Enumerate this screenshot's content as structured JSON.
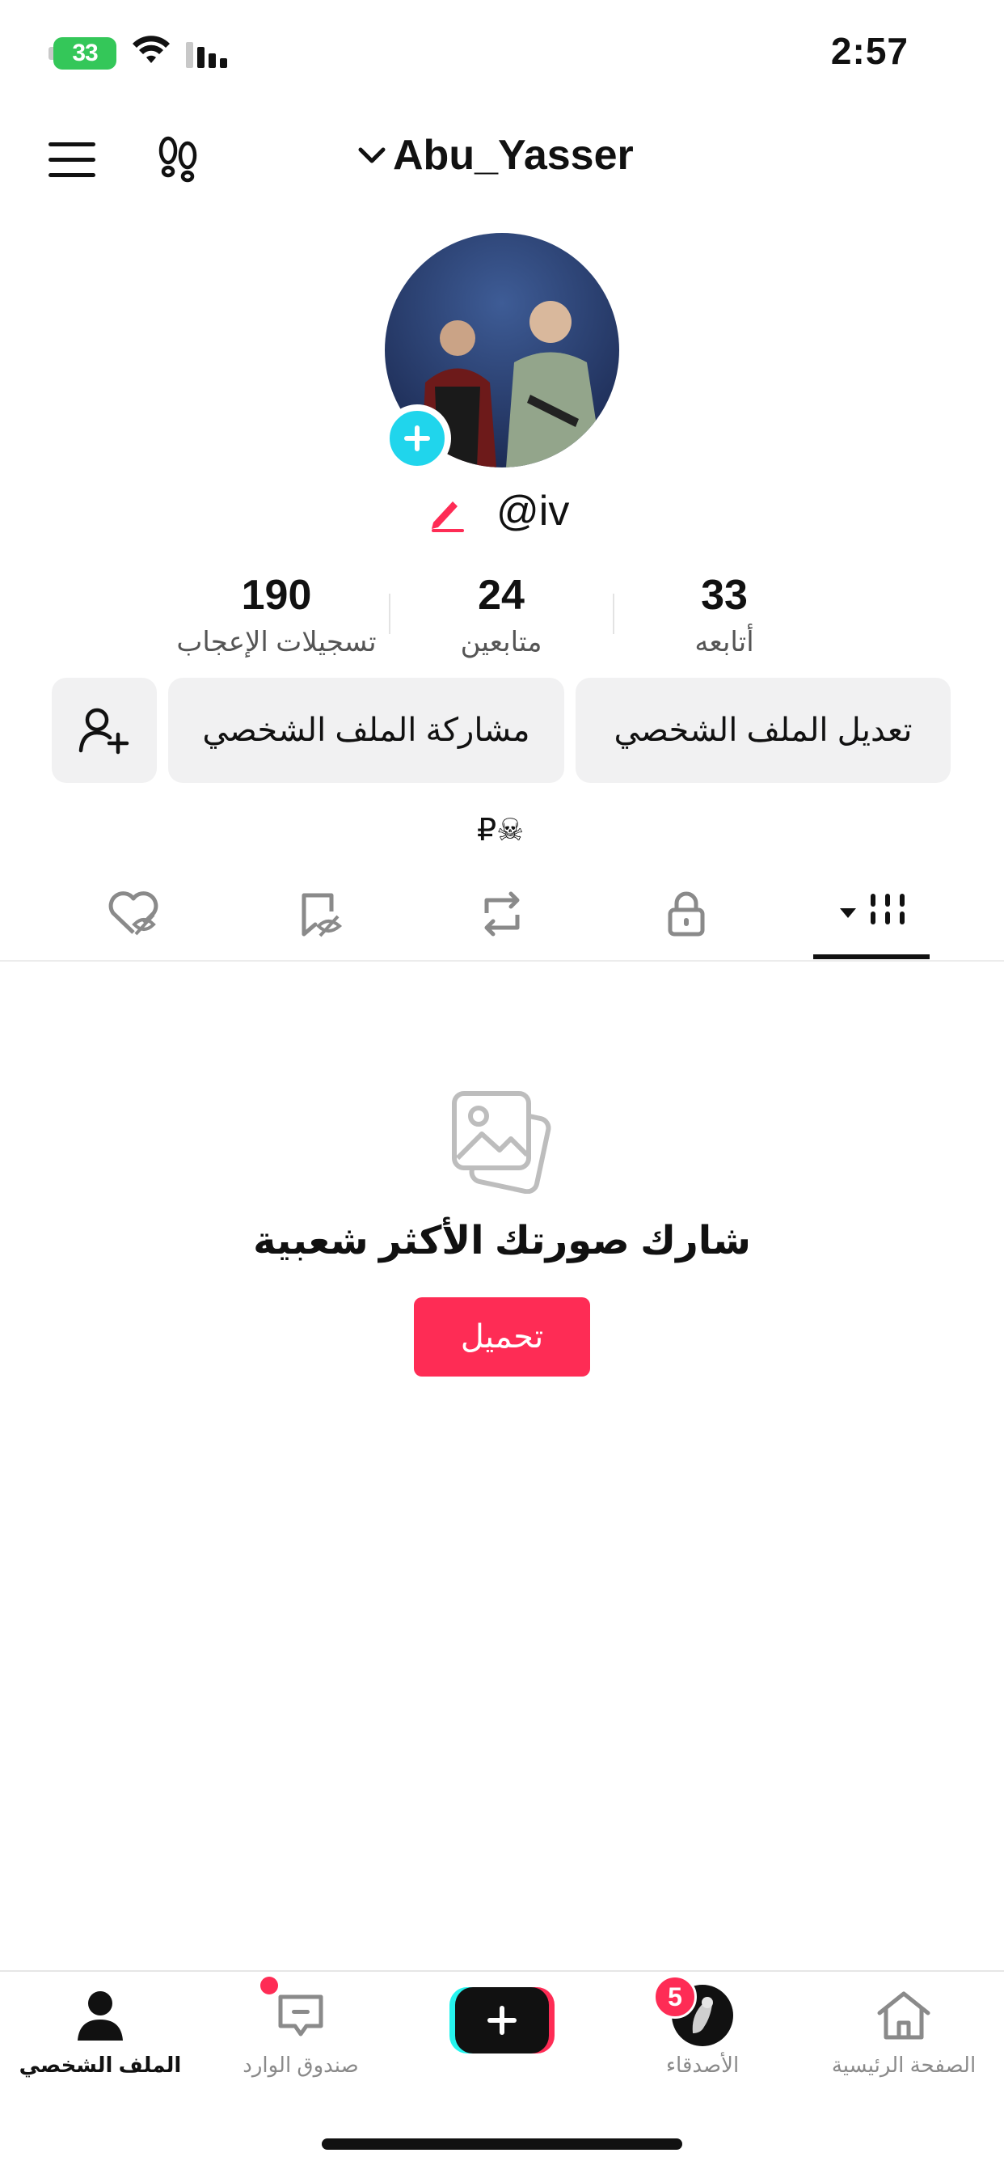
{
  "status_bar": {
    "battery_level": "33",
    "time": "2:57"
  },
  "header": {
    "username": "Abu_Yasser"
  },
  "profile": {
    "handle": "@iv",
    "bio": "₽☠",
    "stats": [
      {
        "count": "190",
        "label": "تسجيلات الإعجاب"
      },
      {
        "count": "24",
        "label": "متابعين"
      },
      {
        "count": "33",
        "label": "أتابعه"
      }
    ],
    "buttons": {
      "share_profile": "مشاركة الملف الشخصي",
      "edit_profile": "تعديل الملف الشخصي"
    }
  },
  "content": {
    "empty_message": "شارك صورتك الأكثر شعبية",
    "upload_label": "تحميل"
  },
  "bottom_nav": {
    "profile": "الملف الشخصي",
    "inbox": "صندوق الوارد",
    "friends": "الأصدقاء",
    "friends_badge": "5",
    "home": "الصفحة الرئيسية"
  },
  "colors": {
    "accent": "#fe2c55",
    "cyan": "#20d5ec",
    "battery": "#34c759"
  }
}
